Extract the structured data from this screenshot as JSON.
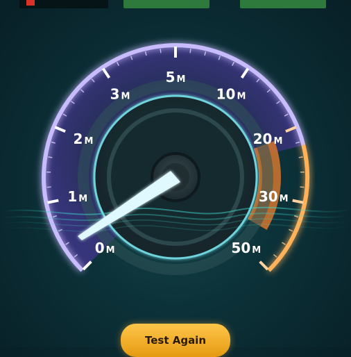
{
  "speed_labels": [
    {
      "num": "0",
      "unit": "M"
    },
    {
      "num": "1",
      "unit": "M"
    },
    {
      "num": "2",
      "unit": "M"
    },
    {
      "num": "3",
      "unit": "M"
    },
    {
      "num": "5",
      "unit": "M"
    },
    {
      "num": "10",
      "unit": "M"
    },
    {
      "num": "20",
      "unit": "M"
    },
    {
      "num": "30",
      "unit": "M"
    },
    {
      "num": "50",
      "unit": "M"
    }
  ],
  "test_button_label": "Test Again",
  "colors": {
    "arc_main": "#b4a6ff",
    "arc_inner": "#4a3f9a",
    "arc_high": "#ff9a36",
    "needle": "#cff6ff",
    "button": "#f5b22c"
  }
}
